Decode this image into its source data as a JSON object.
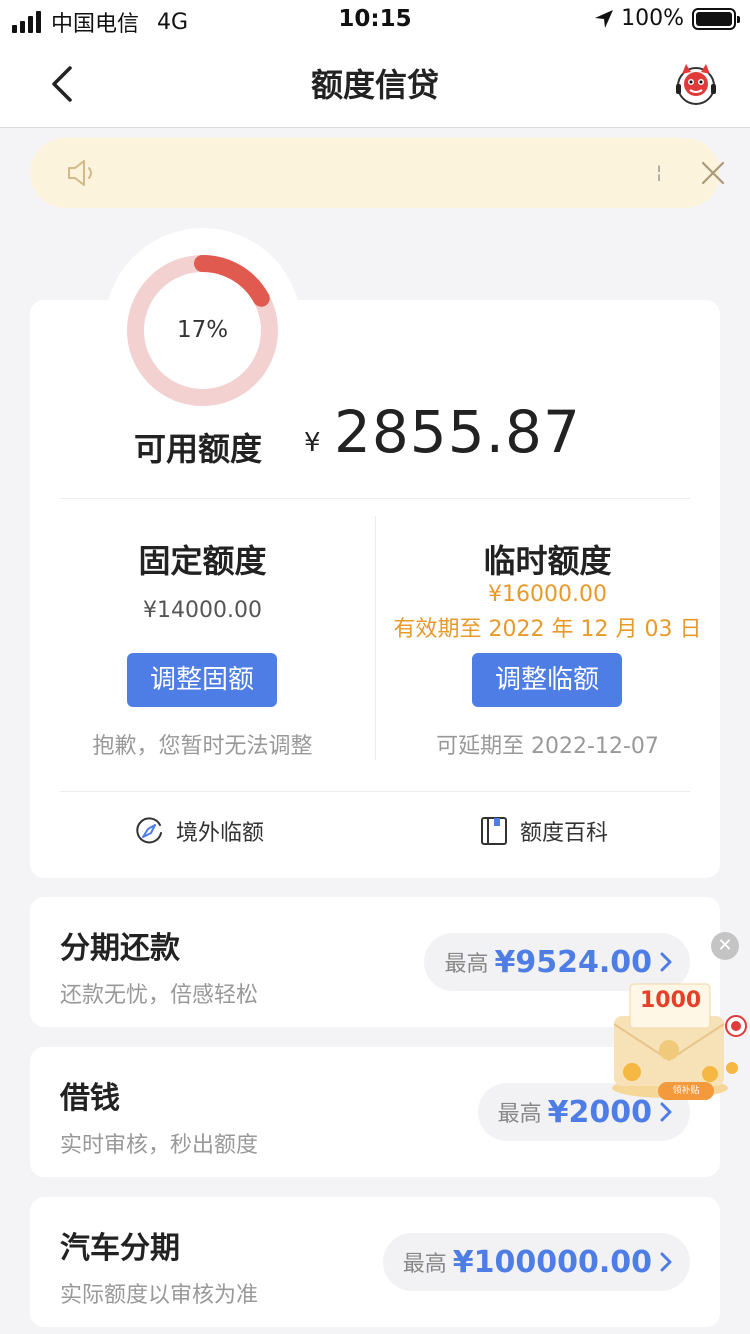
{
  "status_bar": {
    "carrier": "中国电信",
    "network": "4G",
    "time": "10:15",
    "battery": "100%"
  },
  "nav": {
    "title": "额度信贷"
  },
  "notice": {
    "separator": "¦"
  },
  "quota": {
    "usage_percent_label": "17%",
    "usage_fraction": 0.17,
    "available_label": "可用额度",
    "currency": "¥",
    "available_amount": "2855.87",
    "fixed": {
      "title": "固定额度",
      "amount": "¥14000.00",
      "button": "调整固额",
      "note": "抱歉，您暂时无法调整"
    },
    "temporary": {
      "title": "临时额度",
      "amount": "¥16000.00",
      "expiry": "有效期至 2022 年 12 月 03 日",
      "button": "调整临额",
      "note": "可延期至 2022-12-07"
    },
    "links": {
      "overseas": "境外临额",
      "encyclopedia": "额度百科"
    }
  },
  "products": [
    {
      "title": "分期还款",
      "subtitle": "还款无忧，倍感轻松",
      "prefix": "最高",
      "amount": "¥9524.00"
    },
    {
      "title": "借钱",
      "subtitle": "实时审核，秒出额度",
      "prefix": "最高",
      "amount": "¥2000"
    },
    {
      "title": "汽车分期",
      "subtitle": "实际额度以审核为准",
      "prefix": "最高",
      "amount": "¥100000.00"
    }
  ],
  "promo": {
    "amount": "1000",
    "tag": "领补贴"
  },
  "colors": {
    "accent_blue": "#4f7de6",
    "warning_orange": "#e79a2c",
    "ring_red": "#e05a4f",
    "ring_track": "#f3d1d0",
    "notice_bg": "#fcf3dd"
  }
}
